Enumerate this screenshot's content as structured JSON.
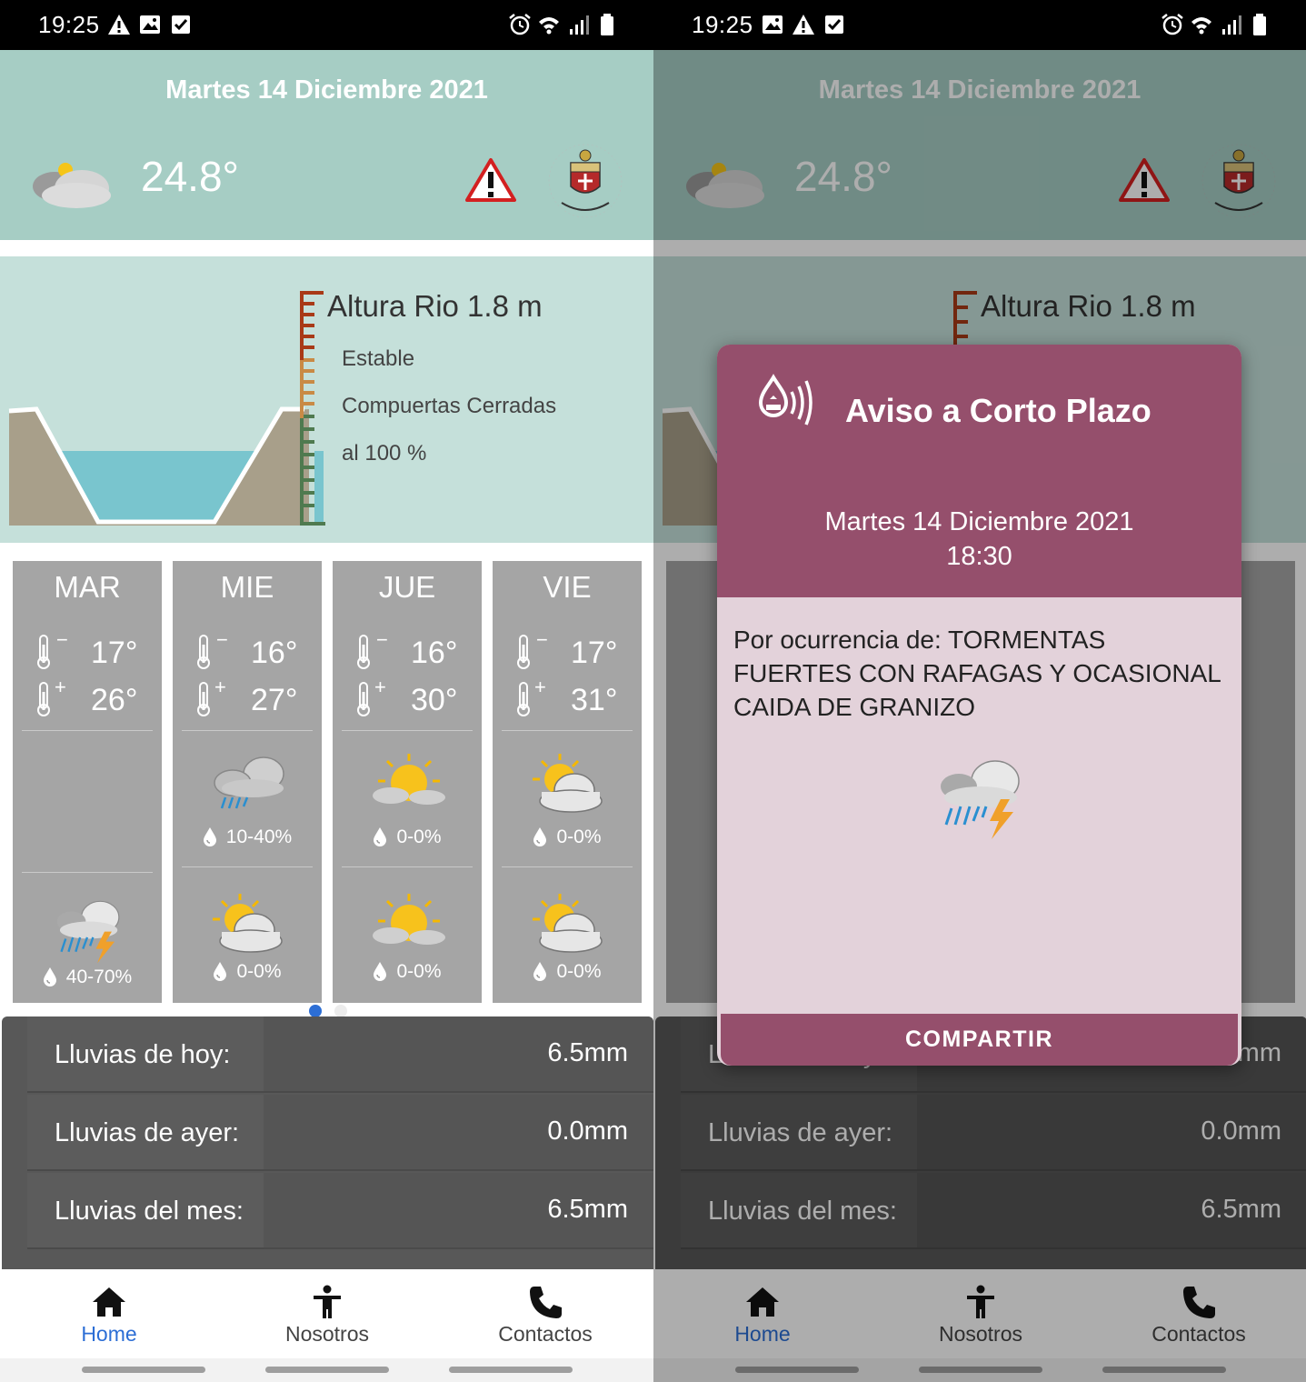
{
  "status_bar": {
    "time": "19:25"
  },
  "header": {
    "date": "Martes 14 Diciembre 2021",
    "temperature": "24.8°"
  },
  "river": {
    "title": "Altura Rio 1.8 m",
    "status": "Estable",
    "gates": "Compuertas Cerradas",
    "percent": "al 100 %"
  },
  "forecast": {
    "days": [
      {
        "name": "MAR",
        "min": "17°",
        "max": "26°",
        "am_rain": "",
        "pm_rain": "40-70%",
        "am_icon": "",
        "pm_icon": "storm-icon"
      },
      {
        "name": "MIE",
        "min": "16°",
        "max": "27°",
        "am_rain": "10-40%",
        "pm_rain": "0-0%",
        "am_icon": "rain-cloud-icon",
        "pm_icon": "partly-cloudy-icon"
      },
      {
        "name": "JUE",
        "min": "16°",
        "max": "30°",
        "am_rain": "0-0%",
        "pm_rain": "0-0%",
        "am_icon": "sun-cloud-icon",
        "pm_icon": "sun-cloud-icon"
      },
      {
        "name": "VIE",
        "min": "17°",
        "max": "31°",
        "am_rain": "0-0%",
        "pm_rain": "0-0%",
        "am_icon": "partly-cloudy-icon",
        "pm_icon": "partly-cloudy-icon"
      }
    ],
    "page_count": 2,
    "active_page": 0
  },
  "rain_stats": [
    {
      "label": "Lluvias de hoy:",
      "value": "6.5mm"
    },
    {
      "label": "Lluvias de ayer:",
      "value": "0.0mm"
    },
    {
      "label": "Lluvias del mes:",
      "value": "6.5mm"
    }
  ],
  "nav": {
    "home": "Home",
    "about": "Nosotros",
    "contacts": "Contactos",
    "active_color": "#2c6ed5"
  },
  "dialog": {
    "title": "Aviso a Corto Plazo",
    "date": "Martes 14 Diciembre 2021",
    "time": "18:30",
    "message": "Por ocurrencia de: TORMENTAS FUERTES CON RAFAGAS Y OCASIONAL CAIDA DE GRANIZO",
    "button": "COMPARTIR",
    "accent": "#954f6c"
  }
}
